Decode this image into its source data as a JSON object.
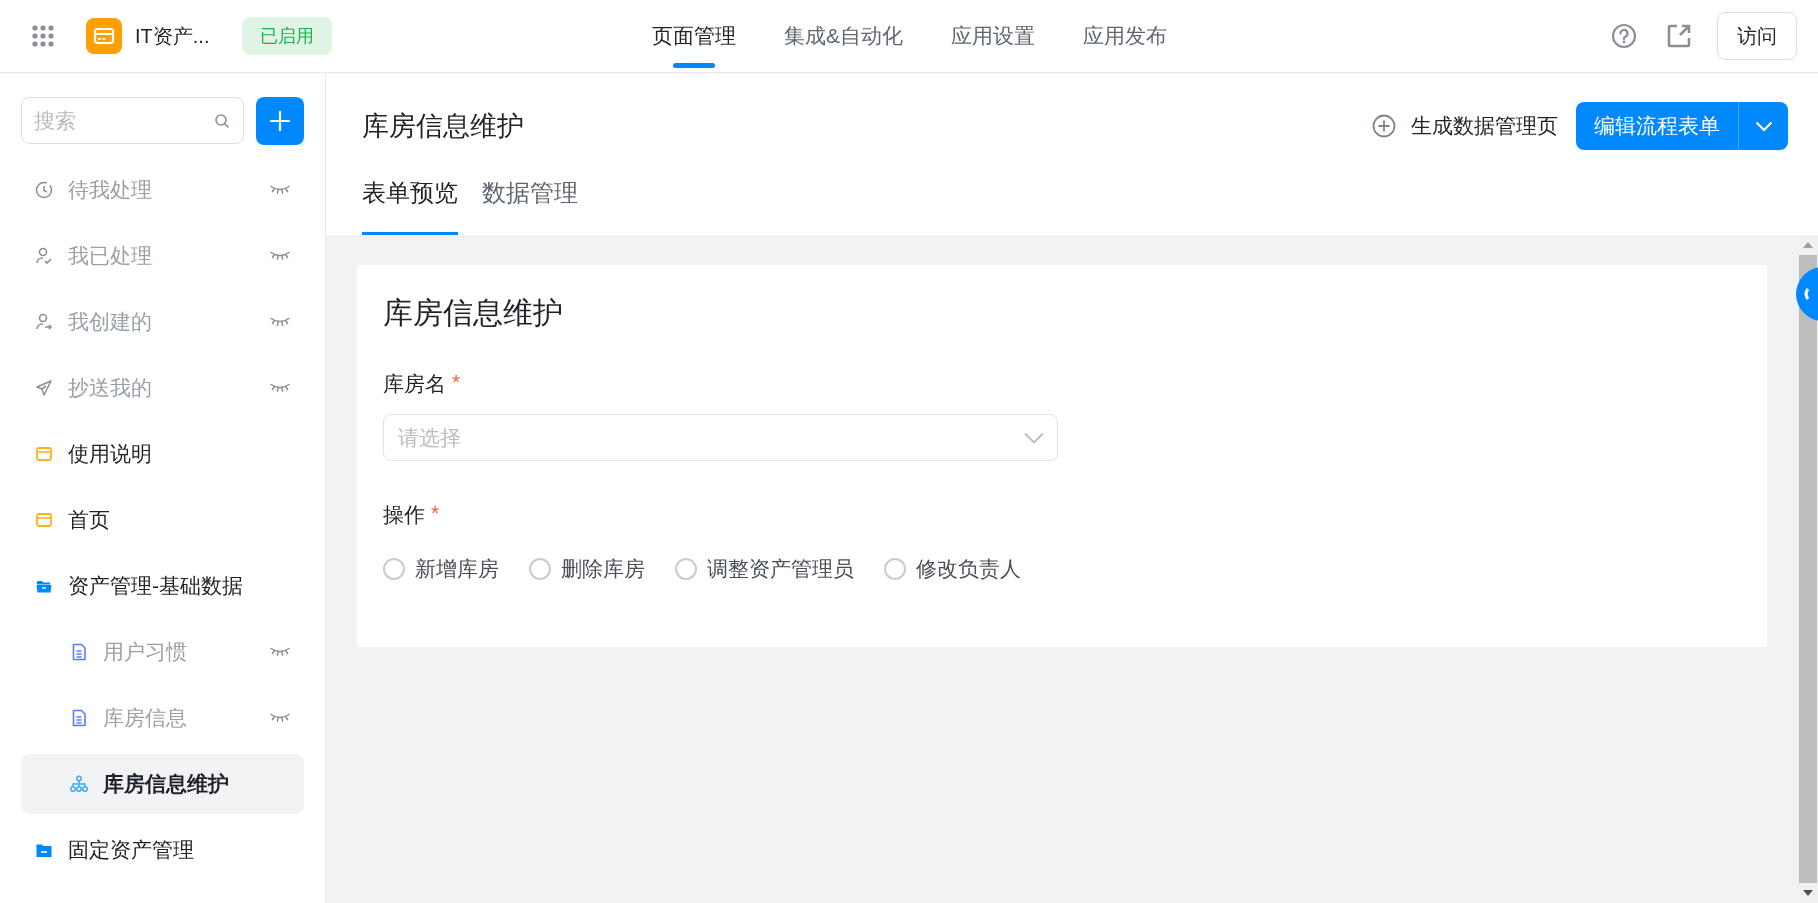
{
  "app": {
    "title": "IT资产...",
    "status": "已启用"
  },
  "top_nav": [
    {
      "label": "页面管理",
      "selected": true
    },
    {
      "label": "集成&自动化",
      "selected": false
    },
    {
      "label": "应用设置",
      "selected": false
    },
    {
      "label": "应用发布",
      "selected": false
    }
  ],
  "visit_button": "访问",
  "sidebar": {
    "search": {
      "placeholder": "搜索"
    },
    "items": [
      {
        "label": "待我处理",
        "kind": "todo",
        "hidden": true,
        "selected": false
      },
      {
        "label": "我已处理",
        "kind": "done",
        "hidden": true,
        "selected": false
      },
      {
        "label": "我创建的",
        "kind": "created",
        "hidden": true,
        "selected": false
      },
      {
        "label": "抄送我的",
        "kind": "cc",
        "hidden": true,
        "selected": false
      },
      {
        "label": "使用说明",
        "kind": "page",
        "hidden": false,
        "selected": false
      },
      {
        "label": "首页",
        "kind": "page",
        "hidden": false,
        "selected": false
      },
      {
        "label": "资产管理-基础数据",
        "kind": "folder",
        "hidden": false,
        "selected": false,
        "expanded": true,
        "children": [
          {
            "label": "用户习惯",
            "kind": "form",
            "hidden": true,
            "selected": false
          },
          {
            "label": "库房信息",
            "kind": "form",
            "hidden": true,
            "selected": false
          },
          {
            "label": "库房信息维护",
            "kind": "flow",
            "hidden": false,
            "selected": true
          }
        ]
      },
      {
        "label": "固定资产管理",
        "kind": "folder",
        "hidden": false,
        "selected": false,
        "expanded": false
      }
    ]
  },
  "page": {
    "title": "库房信息维护",
    "generate_link": "生成数据管理页",
    "edit_button": "编辑流程表单",
    "tabs": [
      {
        "label": "表单预览",
        "selected": true
      },
      {
        "label": "数据管理",
        "selected": false
      }
    ]
  },
  "form": {
    "title": "库房信息维护",
    "fields": [
      {
        "kind": "select",
        "label": "库房名",
        "required_mark": "*",
        "placeholder": "请选择"
      },
      {
        "kind": "radio",
        "label": "操作",
        "required_mark": "*",
        "options": [
          {
            "label": "新增库房",
            "selected": false
          },
          {
            "label": "删除库房",
            "selected": false
          },
          {
            "label": "调整资产管理员",
            "selected": false
          },
          {
            "label": "修改负责人",
            "selected": false
          }
        ]
      }
    ]
  }
}
